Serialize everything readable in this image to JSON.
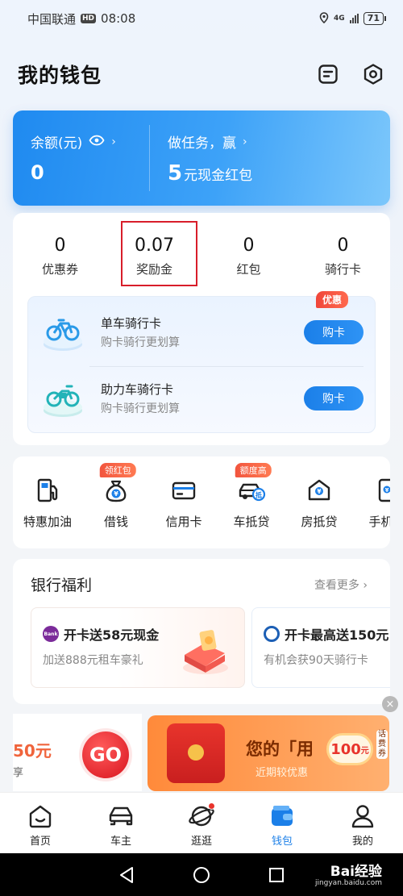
{
  "status_bar": {
    "carrier": "中国联通",
    "hd": "HD",
    "time": "08:08",
    "network": "4G",
    "battery": "71"
  },
  "header": {
    "title": "我的钱包",
    "bill_icon": "bill-icon",
    "settings_icon": "settings-icon"
  },
  "balance": {
    "label": "余额(元)",
    "value": "0",
    "task_label": "做任务，赢",
    "task_amount": "5",
    "task_desc": "元现金红包"
  },
  "assets": [
    {
      "value": "0",
      "label": "优惠券"
    },
    {
      "value": "0.07",
      "label": "奖励金"
    },
    {
      "value": "0",
      "label": "红包"
    },
    {
      "value": "0",
      "label": "骑行卡"
    }
  ],
  "ride_cards": [
    {
      "title": "单车骑行卡",
      "subtitle": "购卡骑行更划算",
      "button": "购卡",
      "tag": "优惠"
    },
    {
      "title": "助力车骑行卡",
      "subtitle": "购卡骑行更划算",
      "button": "购卡"
    }
  ],
  "services": [
    {
      "label": "特惠加油",
      "icon": "gas-pump-icon",
      "badge": ""
    },
    {
      "label": "借钱",
      "icon": "money-bag-icon",
      "badge": "领红包"
    },
    {
      "label": "信用卡",
      "icon": "credit-card-icon",
      "badge": ""
    },
    {
      "label": "车抵贷",
      "icon": "car-loan-icon",
      "badge": "额度高"
    },
    {
      "label": "房抵贷",
      "icon": "house-loan-icon",
      "badge": ""
    },
    {
      "label": "手机充",
      "icon": "phone-recharge-icon",
      "badge": ""
    }
  ],
  "bank": {
    "title": "银行福利",
    "more": "查看更多",
    "offers": [
      {
        "title": "开卡送58元现金",
        "subtitle": "加送888元租车豪礼",
        "logo_text": "Bank"
      },
      {
        "title": "开卡最高送150元",
        "subtitle": "有机会获90天骑行卡"
      }
    ]
  },
  "ads": {
    "left_amount": "50元",
    "left_tail": "享",
    "go": "GO",
    "right_title": "您的「用",
    "right_sub": "近期较优惠",
    "coin_value": "100",
    "coin_unit": "元",
    "side_tag": "话费券"
  },
  "tabbar": [
    {
      "label": "首页",
      "icon": "home-icon"
    },
    {
      "label": "车主",
      "icon": "car-icon"
    },
    {
      "label": "逛逛",
      "icon": "planet-icon"
    },
    {
      "label": "钱包",
      "icon": "wallet-icon",
      "active": true
    },
    {
      "label": "我的",
      "icon": "user-icon"
    }
  ],
  "watermark": {
    "brand": "Bai经验",
    "site": "jingyan.baidu.com"
  },
  "colors": {
    "primary": "#1b7fe8",
    "highlight": "#d81e2a",
    "badge": "#f0463a"
  }
}
